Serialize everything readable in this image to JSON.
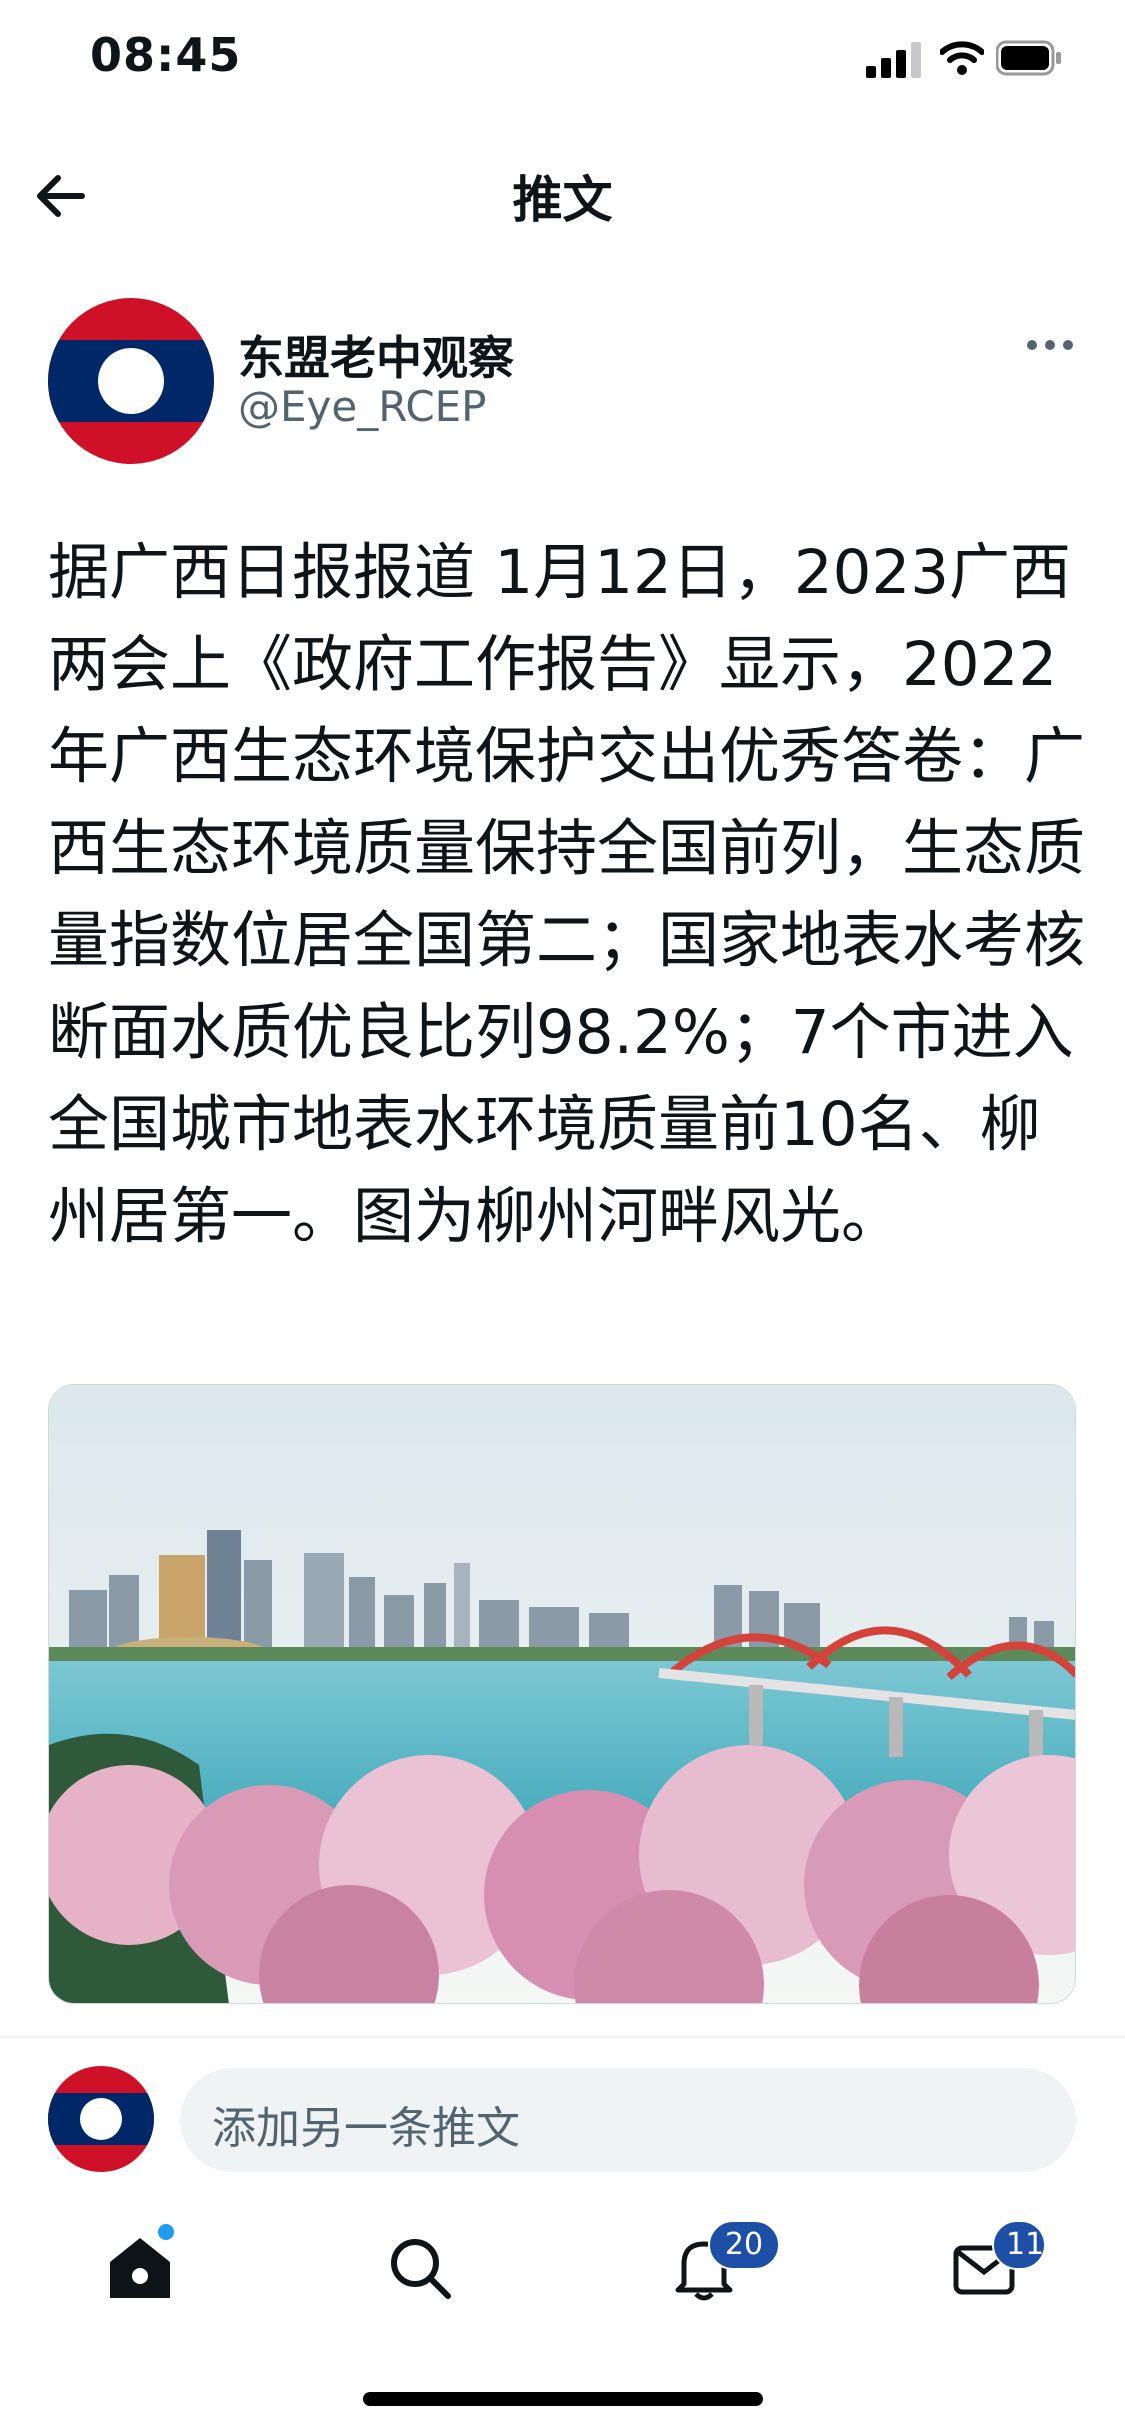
{
  "status_bar": {
    "time": "08:45"
  },
  "header": {
    "title": "推文"
  },
  "author": {
    "name": "东盟老中观察",
    "handle": "@Eye_RCEP"
  },
  "tweet": {
    "text": "据广西日报报道 1月12日，2023广西两会上《政府工作报告》显示，2022年广西生态环境保护交出优秀答卷：广西生态环境质量保持全国前列，生态质量指数位居全国第二；国家地表水考核断面水质优良比列98.2%；7个市进入全国城市地表水环境质量前10名、柳州居第一。图为柳州河畔风光。"
  },
  "reply": {
    "placeholder": "添加另一条推文"
  },
  "nav": {
    "notifications_badge": "20",
    "messages_badge": "11"
  },
  "colors": {
    "accent": "#1d9bf0",
    "badge": "#1d4fa6",
    "lao_red": "#ce1126",
    "lao_blue": "#002868"
  }
}
